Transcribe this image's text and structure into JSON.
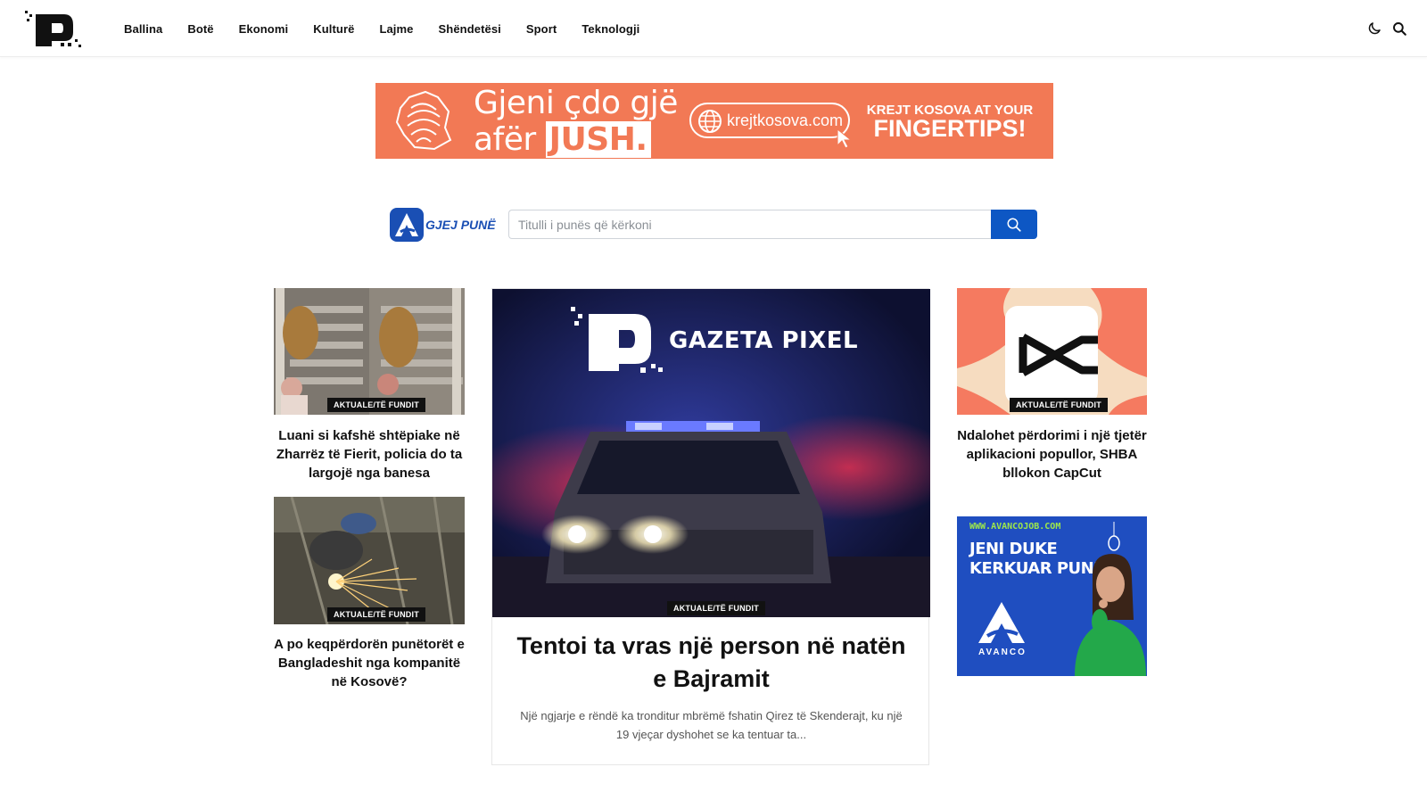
{
  "header": {
    "nav": [
      "Ballina",
      "Botë",
      "Ekonomi",
      "Kulturë",
      "Lajme",
      "Shëndetësi",
      "Sport",
      "Teknologji"
    ]
  },
  "ad_banner": {
    "line1": "Gjeni çdo gjë",
    "line2_prefix": "afër",
    "line2_highlight": "JUSH.",
    "url": "krejtkosova.com",
    "right_line1": "KREJT KOSOVA AT YOUR",
    "right_line2": "FINGERTIPS!",
    "color": "#f27955"
  },
  "job_search": {
    "logo_text": "GJEJ PUNË",
    "placeholder": "Titulli i punës që kërkoni",
    "value": ""
  },
  "articles": {
    "left1": {
      "badge": "AKTUALE/TË FUNDIT",
      "title": "Luani si kafshë shtëpiake në Zharrëz të Fierit, policia do ta largojë nga banesa"
    },
    "left2": {
      "badge": "AKTUALE/TË FUNDIT",
      "title": "A po keqpërdorën punëtorët e Bangladeshit nga kompanitë në Kosovë?"
    },
    "featured": {
      "brand": "GAZETA PIXEL",
      "badge": "AKTUALE/TË FUNDIT",
      "title": "Tentoi ta vras një person në natën e Bajramit",
      "excerpt": "Një ngjarje e rëndë ka tronditur mbrëmë fshatin Qirez të Skenderajt, ku një 19 vjeçar dyshohet se ka tentuar ta..."
    },
    "right1": {
      "badge": "AKTUALE/TË FUNDIT",
      "title": "Ndalohet përdorimi i një tjetër aplikacioni popullor, SHBA bllokon CapCut"
    }
  },
  "side_ad": {
    "url": "WWW.AVANCOJOB.COM",
    "line1": "JENI DUKE",
    "line2": "KERKUAR PUNE?",
    "brand": "AVANCO"
  },
  "colors": {
    "accent_blue": "#0d57c4",
    "badge_bg": "#111111"
  }
}
